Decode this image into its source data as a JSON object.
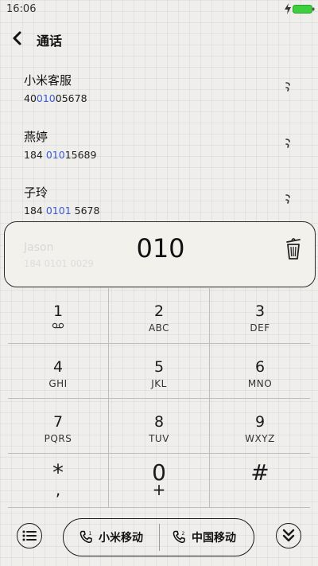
{
  "status_bar": {
    "time": "16:06",
    "battery_color": "#3ecf3e"
  },
  "header": {
    "title": "通话"
  },
  "contacts": [
    {
      "name": "小米客服",
      "number_parts": [
        "40",
        "010",
        "05678"
      ]
    },
    {
      "name": "燕婷",
      "number_parts": [
        "184 ",
        "010",
        "15689"
      ]
    },
    {
      "name": "子玲",
      "number_parts": [
        "184 ",
        "0101",
        " 5678"
      ]
    }
  ],
  "highlight_color": "#3b5bd6",
  "dial": {
    "number": "010",
    "suggestion_name": "Jason",
    "suggestion_number": "184 0101 0029"
  },
  "keypad": [
    {
      "digit": "1",
      "letters": ""
    },
    {
      "digit": "2",
      "letters": "ABC"
    },
    {
      "digit": "3",
      "letters": "DEF"
    },
    {
      "digit": "4",
      "letters": "GHI"
    },
    {
      "digit": "5",
      "letters": "JKL"
    },
    {
      "digit": "6",
      "letters": "MNO"
    },
    {
      "digit": "7",
      "letters": "PQRS"
    },
    {
      "digit": "8",
      "letters": "TUV"
    },
    {
      "digit": "9",
      "letters": "WXYZ"
    },
    {
      "digit": "*",
      "letters": ","
    },
    {
      "digit": "0",
      "letters": "+"
    },
    {
      "digit": "#",
      "letters": ""
    }
  ],
  "sim": [
    {
      "label": "小米移动",
      "slot": "1"
    },
    {
      "label": "中国移动",
      "slot": "2"
    }
  ],
  "icons": {
    "back": "chevron-left-icon",
    "trash": "trash-icon",
    "menu": "list-icon",
    "collapse": "double-chevron-down-icon",
    "phone": "phone-icon"
  }
}
